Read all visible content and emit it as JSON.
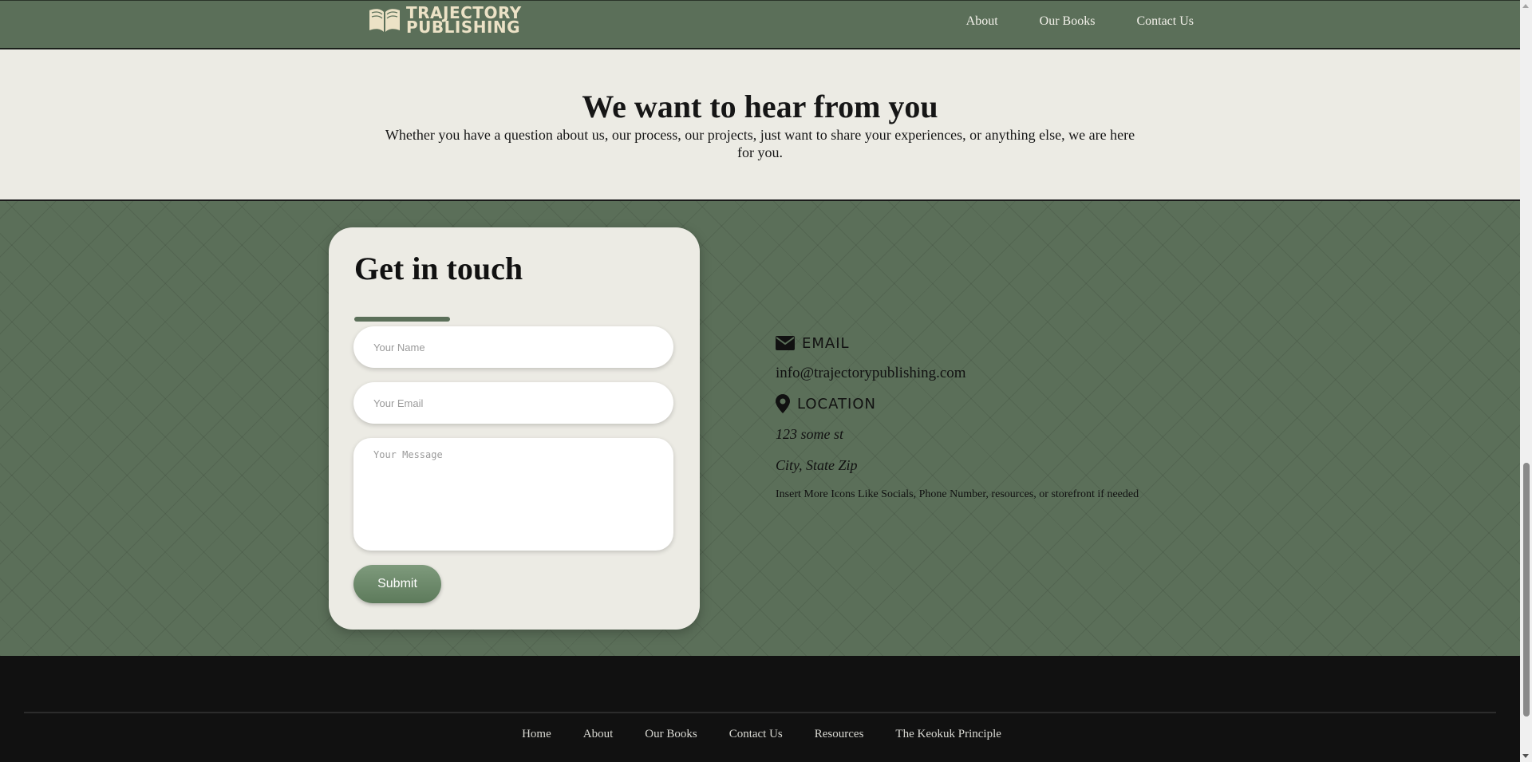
{
  "header": {
    "logo_line1": "TRAJECTORY",
    "logo_line2": "PUBLISHING",
    "logo_icon": "open-book-icon",
    "nav": [
      {
        "label": "About"
      },
      {
        "label": "Our Books"
      },
      {
        "label": "Contact Us"
      }
    ]
  },
  "hero": {
    "title": "We want to hear from you",
    "subtitle": "Whether you have a question about us, our process, our projects, just want to share your experiences, or anything else, we are here for you."
  },
  "form": {
    "title": "Get in touch",
    "name_placeholder": "Your Name",
    "email_placeholder": "Your Email",
    "message_placeholder": "Your Message",
    "submit_label": "Submit"
  },
  "info": {
    "email_icon": "envelope-icon",
    "email_label": "EMAIL",
    "email_value": "info@trajectorypublishing.com",
    "location_icon": "map-pin-icon",
    "location_label": "LOCATION",
    "address_line1": "123 some st",
    "address_line2": "City, State Zip",
    "note": "Insert More Icons Like Socials, Phone Number, resources, or storefront if needed"
  },
  "footer": {
    "nav": [
      {
        "label": "Home"
      },
      {
        "label": "About"
      },
      {
        "label": "Our Books"
      },
      {
        "label": "Contact Us"
      },
      {
        "label": "Resources"
      },
      {
        "label": "The Keokuk Principle"
      }
    ]
  },
  "colors": {
    "brand_green": "#5b6f59",
    "cream": "#ecebe4",
    "footer_black": "#111111",
    "logo_cream": "#ece2c6"
  }
}
